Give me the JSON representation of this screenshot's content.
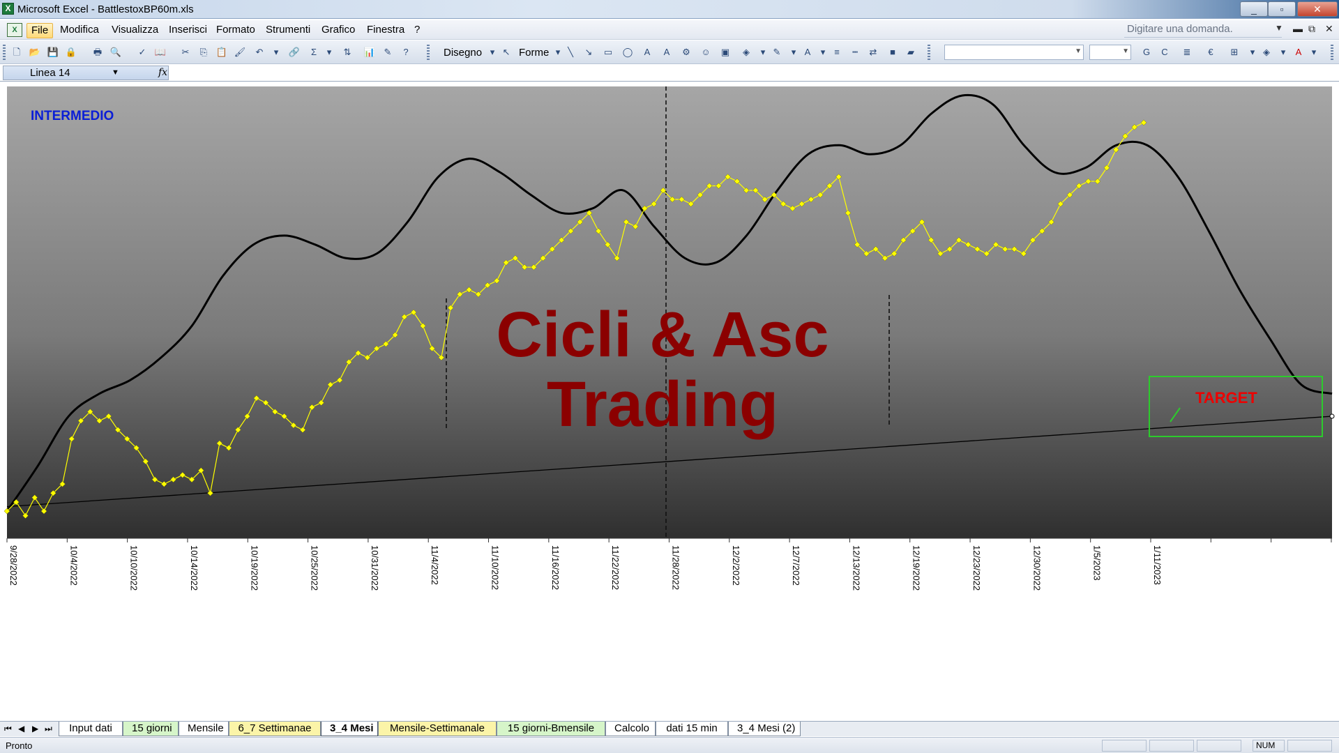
{
  "window": {
    "title": "Microsoft Excel - BattlestoxBP60m.xls",
    "controls": [
      "_",
      "▫",
      "✕"
    ]
  },
  "menu": {
    "items": [
      "File",
      "Modifica",
      "Visualizza",
      "Inserisci",
      "Formato",
      "Strumenti",
      "Grafico",
      "Finestra",
      "?"
    ],
    "active": "File",
    "ask_placeholder": "Digitare una domanda."
  },
  "toolbar": {
    "draw_label": "Disegno",
    "shapes_label": "Forme"
  },
  "formula_bar": {
    "name_box": "Linea 14"
  },
  "chart": {
    "label_intermedio": "INTERMEDIO",
    "watermark_line1": "Cicli & Asc",
    "watermark_line2": "Trading",
    "target_label": "TARGET",
    "colors": {
      "price": "#ffff00",
      "cycle": "#000000",
      "watermark": "#8b0000",
      "target_box": "#2ccc2c",
      "target_text": "#ee0000",
      "intermedio": "#0b1ed6"
    }
  },
  "chart_data": {
    "type": "line",
    "x_tick_labels": [
      "9/28/2022",
      "10/4/2022",
      "10/10/2022",
      "10/14/2022",
      "10/19/2022",
      "10/25/2022",
      "10/31/2022",
      "11/4/2022",
      "11/10/2022",
      "11/16/2022",
      "11/22/2022",
      "11/28/2022",
      "12/2/2022",
      "12/7/2022",
      "12/13/2022",
      "12/19/2022",
      "12/23/2022",
      "12/30/2022",
      "1/5/2023",
      "1/11/2023"
    ],
    "series": [
      {
        "values": [
          0.06,
          0.08,
          0.05,
          0.09,
          0.06,
          0.1,
          0.12,
          0.22,
          0.26,
          0.28,
          0.26,
          0.27,
          0.24,
          0.22,
          0.2,
          0.17,
          0.13,
          0.12,
          0.13,
          0.14,
          0.13,
          0.15,
          0.1,
          0.21,
          0.2,
          0.24,
          0.27,
          0.31,
          0.3,
          0.28,
          0.27,
          0.25,
          0.24,
          0.29,
          0.3,
          0.34,
          0.35,
          0.39,
          0.41,
          0.4,
          0.42,
          0.43,
          0.45,
          0.49,
          0.5,
          0.47,
          0.42,
          0.4,
          0.51,
          0.54,
          0.55,
          0.54,
          0.56,
          0.57,
          0.61,
          0.62,
          0.6,
          0.6,
          0.62,
          0.64,
          0.66,
          0.68,
          0.7,
          0.72,
          0.68,
          0.65,
          0.62,
          0.7,
          0.69,
          0.73,
          0.74,
          0.77,
          0.75,
          0.75,
          0.74,
          0.76,
          0.78,
          0.78,
          0.8,
          0.79,
          0.77,
          0.77,
          0.75,
          0.76,
          0.74,
          0.73,
          0.74,
          0.75,
          0.76,
          0.78,
          0.8,
          0.72,
          0.65,
          0.63,
          0.64,
          0.62,
          0.63,
          0.66,
          0.68,
          0.7,
          0.66,
          0.63,
          0.64,
          0.66,
          0.65,
          0.64,
          0.63,
          0.65,
          0.64,
          0.64,
          0.63,
          0.66,
          0.68,
          0.7,
          0.74,
          0.76,
          0.78,
          0.79,
          0.79,
          0.82,
          0.86,
          0.89,
          0.91,
          0.92
        ]
      },
      {
        "values": [
          0.06,
          0.16,
          0.27,
          0.32,
          0.35,
          0.4,
          0.47,
          0.58,
          0.65,
          0.67,
          0.65,
          0.62,
          0.63,
          0.7,
          0.8,
          0.84,
          0.81,
          0.76,
          0.72,
          0.73,
          0.77,
          0.69,
          0.62,
          0.61,
          0.67,
          0.77,
          0.85,
          0.87,
          0.85,
          0.87,
          0.94,
          0.98,
          0.96,
          0.87,
          0.81,
          0.82,
          0.87,
          0.87,
          0.8,
          0.68,
          0.55,
          0.44,
          0.34,
          0.32
        ]
      }
    ],
    "trendline": [
      0.07,
      0.27
    ],
    "yrange": [
      0,
      1
    ]
  },
  "sheet_tabs": {
    "tabs": [
      {
        "label": "Input dati",
        "style": "plain"
      },
      {
        "label": "15 giorni",
        "style": "green"
      },
      {
        "label": "Mensile",
        "style": "plain"
      },
      {
        "label": "6_7 Settimanae",
        "style": "yellow"
      },
      {
        "label": "3_4 Mesi",
        "style": "active"
      },
      {
        "label": "Mensile-Settimanale",
        "style": "yellow"
      },
      {
        "label": "15 giorni-Bmensile",
        "style": "green"
      },
      {
        "label": "Calcolo",
        "style": "plain"
      },
      {
        "label": "dati 15 min",
        "style": "plain"
      },
      {
        "label": "3_4 Mesi (2)",
        "style": "plain"
      }
    ]
  },
  "status": {
    "ready": "Pronto",
    "num": "NUM"
  }
}
